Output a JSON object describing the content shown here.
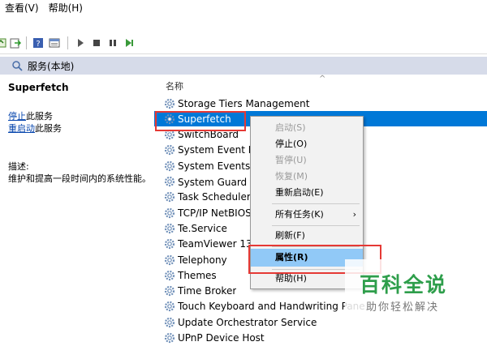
{
  "menubar": {
    "items": [
      {
        "label": "查看(V)"
      },
      {
        "label": "帮助(H)"
      }
    ]
  },
  "pane": {
    "title": "服务(本地)"
  },
  "left_panel": {
    "service_name": "Superfetch",
    "stop_link": "停止",
    "stop_suffix": "此服务",
    "restart_link": "重启动",
    "restart_suffix": "此服务",
    "desc_heading": "描述:",
    "desc_text": "维护和提高一段时间内的系统性能。"
  },
  "list": {
    "column_header": "名称",
    "rows": [
      {
        "name": "Storage Tiers Management"
      },
      {
        "name": "Superfetch"
      },
      {
        "name": "SwitchBoard"
      },
      {
        "name": "System Event No"
      },
      {
        "name": "System Events Br"
      },
      {
        "name": "System Guard 运"
      },
      {
        "name": "Task Scheduler"
      },
      {
        "name": "TCP/IP NetBIOS"
      },
      {
        "name": "Te.Service"
      },
      {
        "name": "TeamViewer 13"
      },
      {
        "name": "Telephony"
      },
      {
        "name": "Themes"
      },
      {
        "name": "Time Broker"
      },
      {
        "name": "Touch Keyboard and Handwriting Pane"
      },
      {
        "name": "Update Orchestrator Service"
      },
      {
        "name": "UPnP Device Host"
      }
    ]
  },
  "context_menu": {
    "items": [
      {
        "label": "启动(S)"
      },
      {
        "label": "停止(O)"
      },
      {
        "label": "暂停(U)"
      },
      {
        "label": "恢复(M)"
      },
      {
        "label": "重新启动(E)"
      },
      {
        "label": "所有任务(K)"
      },
      {
        "label": "刷新(F)"
      },
      {
        "label": "属性(R)"
      },
      {
        "label": "帮助(H)"
      }
    ]
  },
  "watermark": {
    "big": "百科全说",
    "small": "助你轻松解决"
  },
  "colors": {
    "selection": "#0078d7",
    "highlight": "#91c9f7",
    "red_box": "#e53935",
    "watermark_green": "#2e9e4b"
  }
}
